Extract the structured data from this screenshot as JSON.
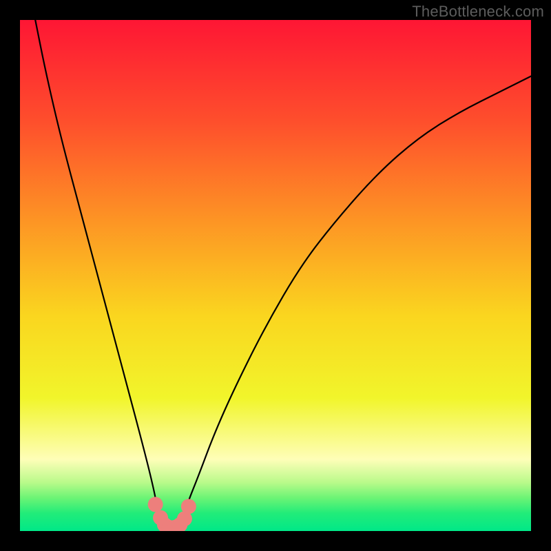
{
  "watermark": "TheBottleneck.com",
  "chart_data": {
    "type": "line",
    "title": "",
    "xlabel": "",
    "ylabel": "",
    "xlim": [
      0,
      100
    ],
    "ylim": [
      0,
      100
    ],
    "series": [
      {
        "name": "bottleneck-curve",
        "x": [
          3,
          5,
          8,
          12,
          16,
          20,
          24,
          26,
          27,
          28,
          29,
          30,
          31,
          32,
          33,
          35,
          38,
          42,
          48,
          55,
          62,
          70,
          78,
          86,
          94,
          100
        ],
        "y": [
          100,
          90,
          77,
          62,
          47,
          32,
          17,
          9,
          4,
          1,
          0,
          0,
          1,
          3,
          6,
          11,
          19,
          28,
          40,
          52,
          61,
          70,
          77,
          82,
          86,
          89
        ]
      }
    ],
    "markers": {
      "name": "low-band-dots",
      "x": [
        26.5,
        27.5,
        28.3,
        29.2,
        30.3,
        31.3,
        32.2,
        33.0
      ],
      "y": [
        5.2,
        2.6,
        1.2,
        0.7,
        0.7,
        1.2,
        2.4,
        4.8
      ],
      "color": "#ed7f7c",
      "size": 11
    },
    "gradient": {
      "stops": [
        {
          "offset": 0.0,
          "color": "#fe1634"
        },
        {
          "offset": 0.2,
          "color": "#fe4f2c"
        },
        {
          "offset": 0.4,
          "color": "#fd9724"
        },
        {
          "offset": 0.58,
          "color": "#fad61f"
        },
        {
          "offset": 0.74,
          "color": "#f1f52b"
        },
        {
          "offset": 0.86,
          "color": "#fefeb8"
        },
        {
          "offset": 0.905,
          "color": "#b9fa8a"
        },
        {
          "offset": 0.935,
          "color": "#6cf475"
        },
        {
          "offset": 0.965,
          "color": "#22ec79"
        },
        {
          "offset": 1.0,
          "color": "#00e888"
        }
      ]
    }
  }
}
